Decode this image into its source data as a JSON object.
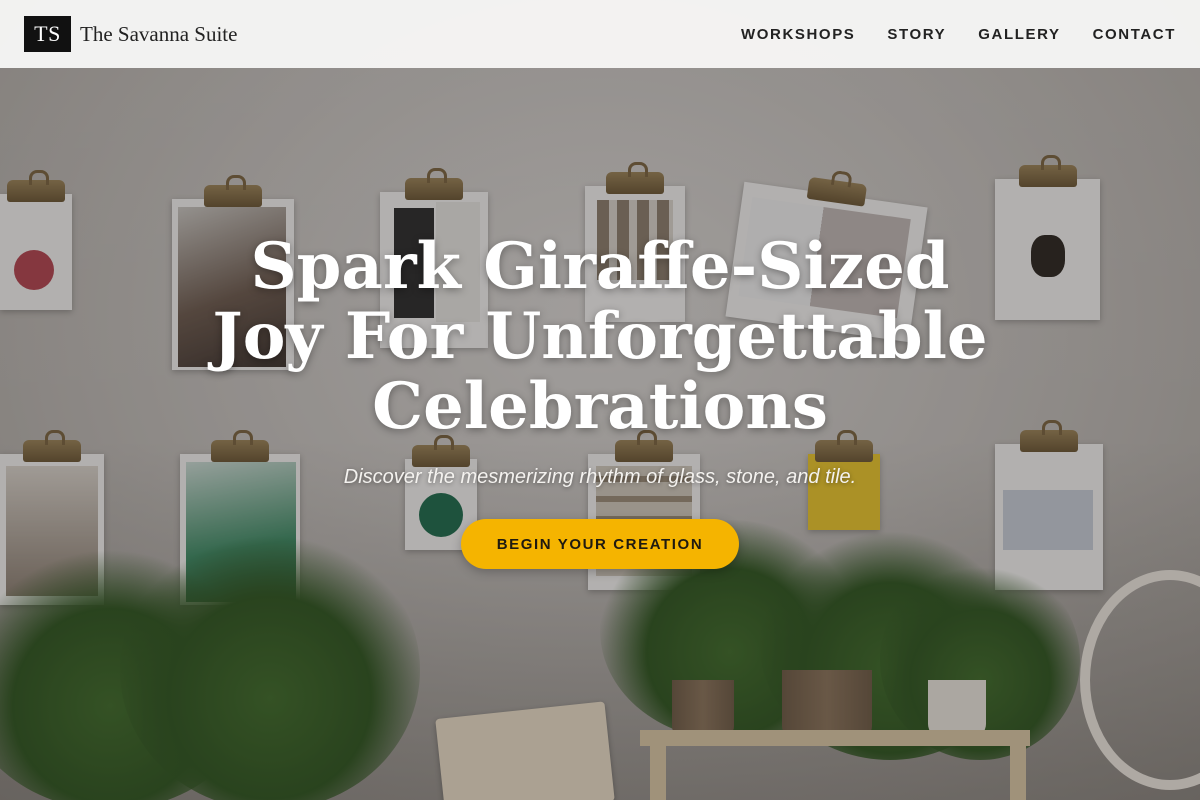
{
  "brand": {
    "logo_text": "TS",
    "name": "The Savanna Suite"
  },
  "nav": {
    "links": [
      {
        "label": "WORKSHOPS"
      },
      {
        "label": "STORY"
      },
      {
        "label": "GALLERY"
      },
      {
        "label": "CONTACT"
      }
    ]
  },
  "hero": {
    "title": "Spark Giraffe-Sized Joy For Unforgettable Celebrations",
    "subtitle": "Discover the mesmerizing rhythm of glass, stone, and tile.",
    "cta_label": "BEGIN YOUR CREATION",
    "background_description_icon": "photo-background"
  },
  "colors": {
    "accent": "#f5b400",
    "nav_background": "#f8f8f7",
    "logo_background": "#111111",
    "title_text": "#ffffff"
  }
}
